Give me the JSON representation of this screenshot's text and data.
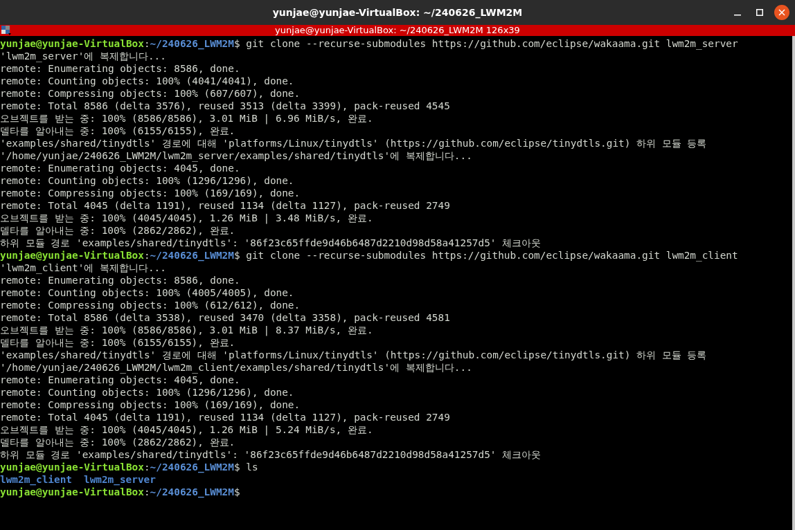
{
  "window": {
    "title": "yunjae@yunjae-VirtualBox: ~/240626_LWM2M"
  },
  "terminal_bar": {
    "title": "yunjae@yunjae-VirtualBox: ~/240626_LWM2M 126x39"
  },
  "lines": [
    {
      "kind": "prompt",
      "user": "yunjae@yunjae-VirtualBox",
      "colon": ":",
      "path": "~/240626_LWM2M",
      "sigil": "$",
      "command": " git clone --recurse-submodules https://github.com/eclipse/wakaama.git lwm2m_server"
    },
    {
      "kind": "output",
      "text": "'lwm2m_server'에 복제합니다..."
    },
    {
      "kind": "output",
      "text": "remote: Enumerating objects: 8586, done."
    },
    {
      "kind": "output",
      "text": "remote: Counting objects: 100% (4041/4041), done."
    },
    {
      "kind": "output",
      "text": "remote: Compressing objects: 100% (607/607), done."
    },
    {
      "kind": "output",
      "text": "remote: Total 8586 (delta 3576), reused 3513 (delta 3399), pack-reused 4545"
    },
    {
      "kind": "output",
      "text": "오브젝트를 받는 중: 100% (8586/8586), 3.01 MiB | 6.96 MiB/s, 완료."
    },
    {
      "kind": "output",
      "text": "델타를 알아내는 중: 100% (6155/6155), 완료."
    },
    {
      "kind": "output",
      "text": "'examples/shared/tinydtls' 경로에 대해 'platforms/Linux/tinydtls' (https://github.com/eclipse/tinydtls.git) 하위 모듈 등록"
    },
    {
      "kind": "output",
      "text": "'/home/yunjae/240626_LWM2M/lwm2m_server/examples/shared/tinydtls'에 복제합니다..."
    },
    {
      "kind": "output",
      "text": "remote: Enumerating objects: 4045, done."
    },
    {
      "kind": "output",
      "text": "remote: Counting objects: 100% (1296/1296), done."
    },
    {
      "kind": "output",
      "text": "remote: Compressing objects: 100% (169/169), done."
    },
    {
      "kind": "output",
      "text": "remote: Total 4045 (delta 1191), reused 1134 (delta 1127), pack-reused 2749"
    },
    {
      "kind": "output",
      "text": "오브젝트를 받는 중: 100% (4045/4045), 1.26 MiB | 3.48 MiB/s, 완료."
    },
    {
      "kind": "output",
      "text": "델타를 알아내는 중: 100% (2862/2862), 완료."
    },
    {
      "kind": "output",
      "text": "하위 모듈 경로 'examples/shared/tinydtls': '86f23c65ffde9d46b6487d2210d98d58a41257d5' 체크아웃"
    },
    {
      "kind": "prompt",
      "user": "yunjae@yunjae-VirtualBox",
      "colon": ":",
      "path": "~/240626_LWM2M",
      "sigil": "$",
      "command": " git clone --recurse-submodules https://github.com/eclipse/wakaama.git lwm2m_client"
    },
    {
      "kind": "output",
      "text": "'lwm2m_client'에 복제합니다..."
    },
    {
      "kind": "output",
      "text": "remote: Enumerating objects: 8586, done."
    },
    {
      "kind": "output",
      "text": "remote: Counting objects: 100% (4005/4005), done."
    },
    {
      "kind": "output",
      "text": "remote: Compressing objects: 100% (612/612), done."
    },
    {
      "kind": "output",
      "text": "remote: Total 8586 (delta 3538), reused 3470 (delta 3358), pack-reused 4581"
    },
    {
      "kind": "output",
      "text": "오브젝트를 받는 중: 100% (8586/8586), 3.01 MiB | 8.37 MiB/s, 완료."
    },
    {
      "kind": "output",
      "text": "델타를 알아내는 중: 100% (6155/6155), 완료."
    },
    {
      "kind": "output",
      "text": "'examples/shared/tinydtls' 경로에 대해 'platforms/Linux/tinydtls' (https://github.com/eclipse/tinydtls.git) 하위 모듈 등록"
    },
    {
      "kind": "output",
      "text": "'/home/yunjae/240626_LWM2M/lwm2m_client/examples/shared/tinydtls'에 복제합니다..."
    },
    {
      "kind": "output",
      "text": "remote: Enumerating objects: 4045, done."
    },
    {
      "kind": "output",
      "text": "remote: Counting objects: 100% (1296/1296), done."
    },
    {
      "kind": "output",
      "text": "remote: Compressing objects: 100% (169/169), done."
    },
    {
      "kind": "output",
      "text": "remote: Total 4045 (delta 1191), reused 1134 (delta 1127), pack-reused 2749"
    },
    {
      "kind": "output",
      "text": "오브젝트를 받는 중: 100% (4045/4045), 1.26 MiB | 5.24 MiB/s, 완료."
    },
    {
      "kind": "output",
      "text": "델타를 알아내는 중: 100% (2862/2862), 완료."
    },
    {
      "kind": "output",
      "text": "하위 모듈 경로 'examples/shared/tinydtls': '86f23c65ffde9d46b6487d2210d98d58a41257d5' 체크아웃"
    },
    {
      "kind": "prompt",
      "user": "yunjae@yunjae-VirtualBox",
      "colon": ":",
      "path": "~/240626_LWM2M",
      "sigil": "$",
      "command": " ls"
    },
    {
      "kind": "listing",
      "entries": [
        "lwm2m_client",
        "lwm2m_server"
      ]
    },
    {
      "kind": "prompt",
      "user": "yunjae@yunjae-VirtualBox",
      "colon": ":",
      "path": "~/240626_LWM2M",
      "sigil": "$"
    }
  ]
}
